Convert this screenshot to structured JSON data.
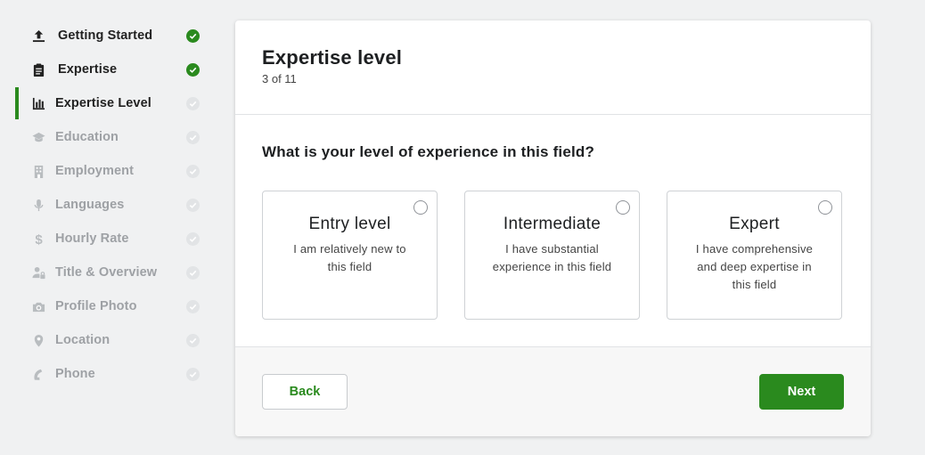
{
  "sidebar": {
    "items": [
      {
        "label": "Getting Started",
        "icon": "upload-icon",
        "state": "done"
      },
      {
        "label": "Expertise",
        "icon": "clipboard-icon",
        "state": "done"
      },
      {
        "label": "Expertise Level",
        "icon": "bar-chart-icon",
        "state": "active"
      },
      {
        "label": "Education",
        "icon": "graduation-cap-icon",
        "state": "pending"
      },
      {
        "label": "Employment",
        "icon": "building-icon",
        "state": "pending"
      },
      {
        "label": "Languages",
        "icon": "microphone-icon",
        "state": "pending"
      },
      {
        "label": "Hourly Rate",
        "icon": "dollar-icon",
        "state": "pending"
      },
      {
        "label": "Title & Overview",
        "icon": "user-lock-icon",
        "state": "pending"
      },
      {
        "label": "Profile Photo",
        "icon": "camera-icon",
        "state": "pending"
      },
      {
        "label": "Location",
        "icon": "map-pin-icon",
        "state": "pending"
      },
      {
        "label": "Phone",
        "icon": "phone-icon",
        "state": "pending"
      }
    ]
  },
  "card": {
    "title": "Expertise level",
    "progress": "3 of 11",
    "question": "What is your level of experience in this field?",
    "options": [
      {
        "title": "Entry level",
        "description": "I am relatively new to this field",
        "selected": false
      },
      {
        "title": "Intermediate",
        "description": "I have substantial experience in this field",
        "selected": false
      },
      {
        "title": "Expert",
        "description": "I have comprehensive and deep expertise in this field",
        "selected": false
      }
    ],
    "back_label": "Back",
    "next_label": "Next"
  },
  "colors": {
    "accent": "#2a8a1e",
    "pending_check": "#e2e4e6",
    "background": "#f0f1f2"
  }
}
